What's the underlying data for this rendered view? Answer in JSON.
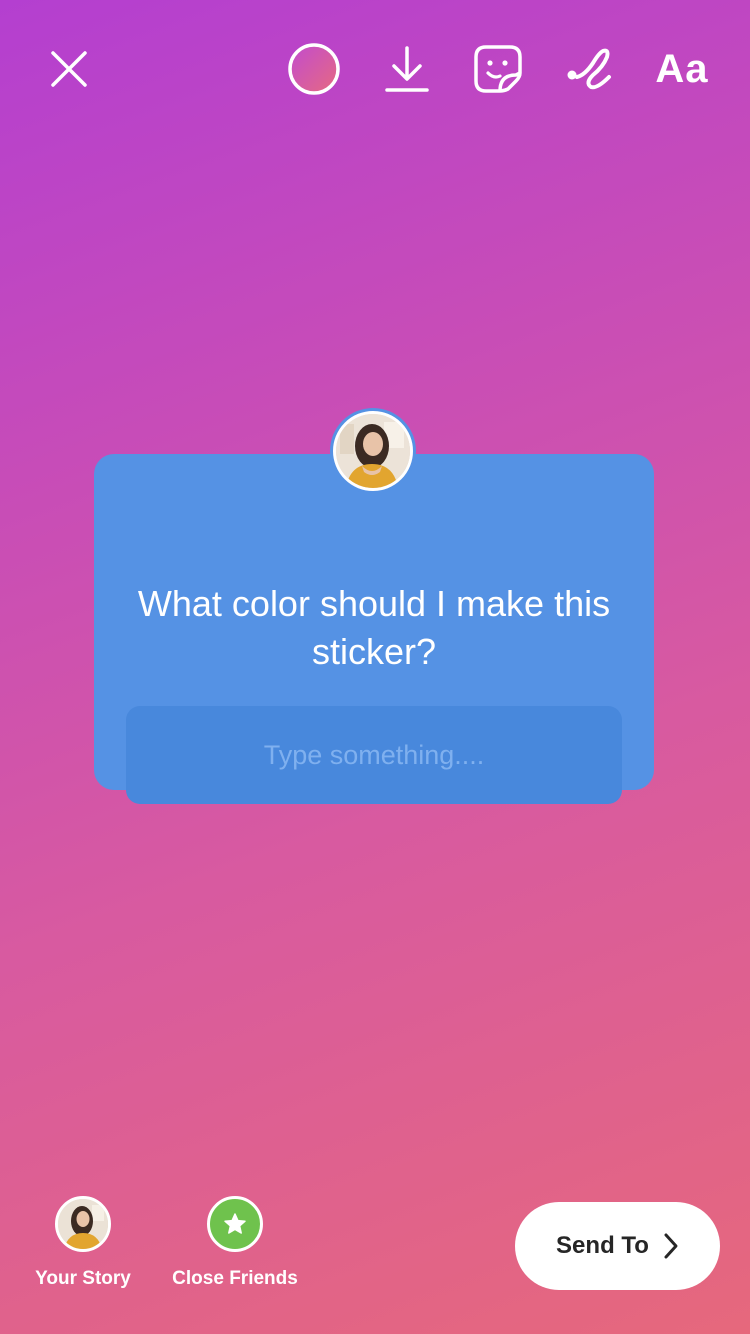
{
  "toolbar": {
    "text_tool_label": "Aa"
  },
  "question_sticker": {
    "question": "What color should I make this sticker?",
    "placeholder": "Type something....",
    "color": "#5592e4"
  },
  "share": {
    "your_story_label": "Your Story",
    "close_friends_label": "Close Friends",
    "send_label": "Send To"
  },
  "icons": [
    "close-icon",
    "color-picker-icon",
    "download-icon",
    "sticker-icon",
    "draw-icon",
    "star-icon",
    "chevron-right-icon"
  ],
  "colors": {
    "background_top": "#b43fd0",
    "background_bottom": "#e6687c",
    "close_friends_green": "#6fc24d"
  }
}
